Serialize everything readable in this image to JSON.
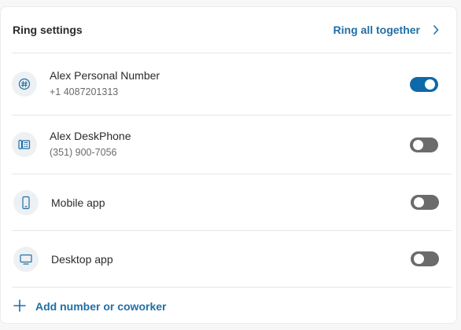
{
  "header": {
    "title": "Ring settings",
    "ring_link_label": "Ring all together"
  },
  "devices": [
    {
      "name": "Alex Personal Number",
      "detail": "+1 4087201313",
      "icon": "hash-icon",
      "enabled": true
    },
    {
      "name": "Alex DeskPhone",
      "detail": "(351) 900-7056",
      "icon": "desk-phone-icon",
      "enabled": false
    },
    {
      "name": "Mobile app",
      "detail": "",
      "icon": "mobile-phone-icon",
      "enabled": false
    },
    {
      "name": "Desktop app",
      "detail": "",
      "icon": "desktop-monitor-icon",
      "enabled": false
    }
  ],
  "footer": {
    "add_label": "Add number or coworker"
  },
  "colors": {
    "accent": "#1f6fa6",
    "toggle_on": "#0e69a8",
    "toggle_off": "#6b6b6b"
  }
}
